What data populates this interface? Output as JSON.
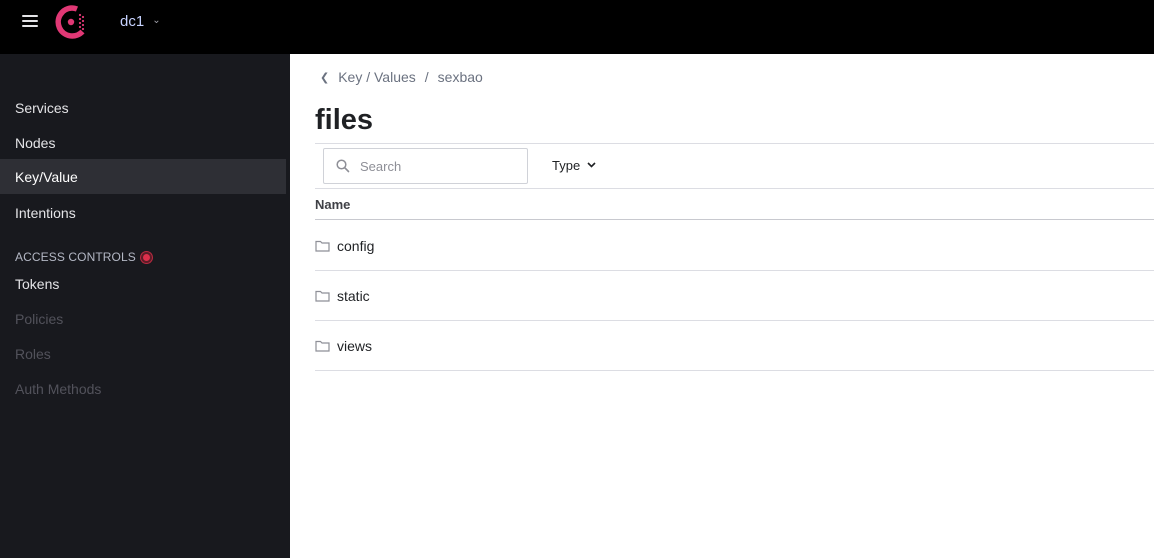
{
  "topbar": {
    "menu_icon": "hamburger-icon",
    "logo_icon": "consul-logo",
    "brand_color": "#e03875",
    "datacenter": "dc1",
    "datacenter_icon": "chevron-down-icon"
  },
  "sidebar": {
    "items": [
      {
        "label": "Services",
        "state": "normal"
      },
      {
        "label": "Nodes",
        "state": "normal"
      },
      {
        "label": "Key/Value",
        "state": "active"
      },
      {
        "label": "Intentions",
        "state": "normal"
      }
    ],
    "section_label": "ACCESS CONTROLS",
    "section_badge_color": "#dc2f4b",
    "acl_items": [
      {
        "label": "Tokens",
        "state": "normal"
      },
      {
        "label": "Policies",
        "state": "disabled"
      },
      {
        "label": "Roles",
        "state": "disabled"
      },
      {
        "label": "Auth Methods",
        "state": "disabled"
      }
    ]
  },
  "main": {
    "breadcrumb": {
      "back_icon": "chevron-left-icon",
      "root": "Key / Values",
      "separator": "/",
      "current": "sexbao"
    },
    "title": "files",
    "search": {
      "placeholder": "Search",
      "value": "",
      "icon": "search-icon"
    },
    "type_filter": {
      "label": "Type",
      "icon": "chevron-down-icon"
    },
    "table": {
      "columns": [
        "Name"
      ],
      "rows": [
        {
          "name": "config",
          "icon": "folder-icon"
        },
        {
          "name": "static",
          "icon": "folder-icon"
        },
        {
          "name": "views",
          "icon": "folder-icon"
        }
      ]
    }
  }
}
